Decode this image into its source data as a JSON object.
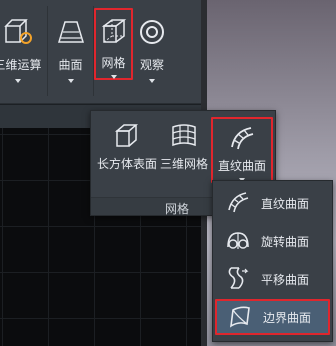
{
  "ribbon": {
    "buttons": [
      {
        "label": "三维运算",
        "icon": "3d-operation-icon"
      },
      {
        "label": "曲面",
        "icon": "surface-icon"
      },
      {
        "label": "网格",
        "icon": "mesh-cube-icon"
      },
      {
        "label": "观察",
        "icon": "view-icon"
      }
    ]
  },
  "mesh_panel": {
    "title": "网格",
    "tools": [
      {
        "label": "长方体表面",
        "icon": "box-surface-icon"
      },
      {
        "label": "三维网格",
        "icon": "3d-mesh-icon"
      },
      {
        "label": "直纹曲面",
        "icon": "ruled-surface-icon"
      }
    ]
  },
  "dropdown": {
    "items": [
      {
        "label": "直纹曲面",
        "icon": "ruled-surface-icon"
      },
      {
        "label": "旋转曲面",
        "icon": "revolved-surface-icon"
      },
      {
        "label": "平移曲面",
        "icon": "tabulated-surface-icon"
      },
      {
        "label": "边界曲面",
        "icon": "edge-surface-icon"
      }
    ]
  },
  "colors": {
    "highlight_border": "#e0262d",
    "panel_bg": "#3a4047",
    "selected_item_bg": "#4a5f75"
  }
}
